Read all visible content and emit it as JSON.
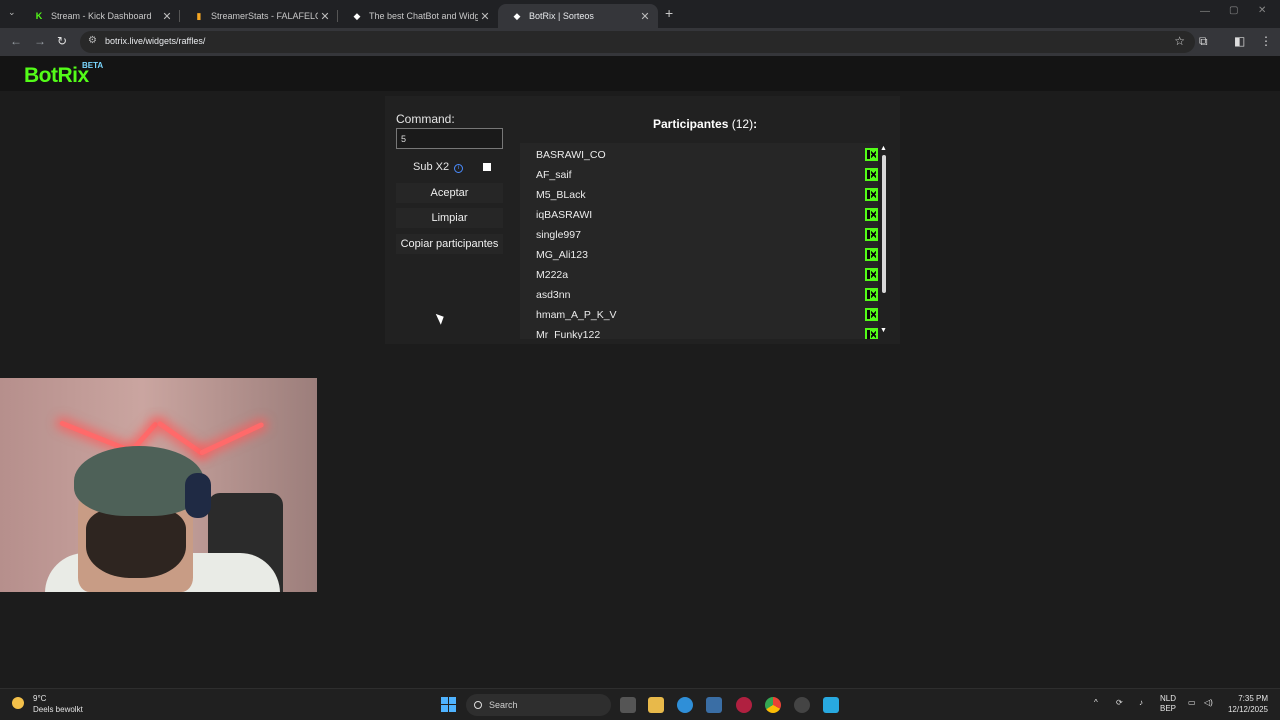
{
  "browser": {
    "tabs": [
      {
        "title": "Stream - Kick Dashboard",
        "favicon": "kick-icon"
      },
      {
        "title": "StreamerStats - FALAFELCO Pr",
        "favicon": "chart-icon"
      },
      {
        "title": "The best ChatBot and Widgets",
        "favicon": "botrix-icon"
      },
      {
        "title": "BotRix | Sorteos",
        "favicon": "botrix-icon"
      }
    ],
    "url": "botrix.live/widgets/raffles/"
  },
  "site": {
    "logo": "BotRix",
    "beta": "BETA"
  },
  "raffle": {
    "command_label": "Command:",
    "command_value": "5",
    "sub_label": "Sub X2",
    "sub_checked": false,
    "accept_label": "Aceptar",
    "clear_label": "Limpiar",
    "copy_label": "Copiar participantes",
    "participants_label": "Participantes",
    "participants_count": "(12)",
    "participants_suffix": ":",
    "participants": [
      "BASRAWI_CO",
      "AF_saif",
      "M5_BLack",
      "iqBASRAWI",
      "single997",
      "MG_Ali123",
      "M222a",
      "asd3nn",
      "hmam_A_P_K_V",
      "Mr_Funky122"
    ]
  },
  "taskbar": {
    "weather_temp": "9°C",
    "weather_desc": "Deels bewolkt",
    "search_label": "Search",
    "lang_top": "NLD",
    "lang_bottom": "BEP",
    "time": "7:35 PM",
    "date": "12/12/2025"
  },
  "colors": {
    "kick_green": "#53fc18",
    "page_bg": "#1c1c1c",
    "panel_bg": "#212121"
  }
}
